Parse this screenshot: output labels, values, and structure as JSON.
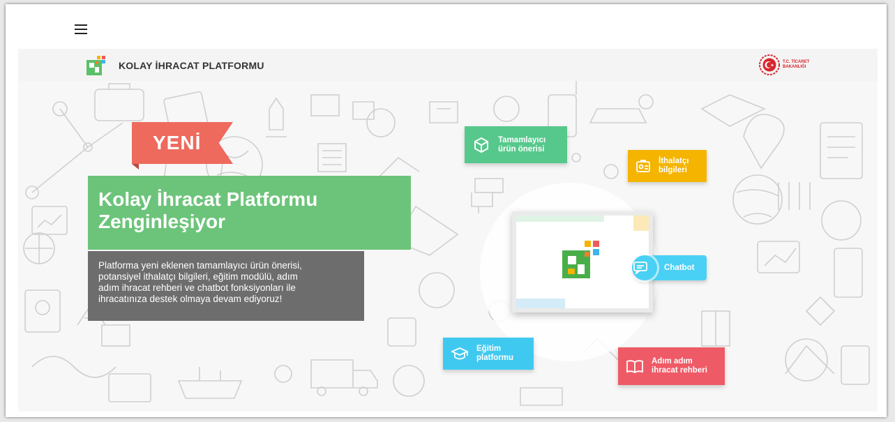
{
  "header": {
    "brand_name": "KOLAY İHRACAT PLATFORMU",
    "ministry_line1": "T.C. TİCARET",
    "ministry_line2": "BAKANLIĞI"
  },
  "hero": {
    "ribbon": "YENİ",
    "headline_line1": "Kolay İhracat Platformu",
    "headline_line2": "Zenginleşiyor",
    "summary_lines": [
      "Platforma yeni eklenen tamamlayıcı ürün önerisi,",
      "potansiyel ithalatçı bilgileri, eğitim modülü, adım",
      "adım ihracat rehberi ve chatbot fonksiyonları ile",
      "ihracatınıza destek olmaya devam ediyoruz!"
    ]
  },
  "features": {
    "product": {
      "line1": "Tamamlayıcı",
      "line2": "ürün önerisi",
      "icon": "cube-icon"
    },
    "importer": {
      "line1": "İthalatçı",
      "line2": "bilgileri",
      "icon": "id-card-icon"
    },
    "chatbot": {
      "label": "Chatbot",
      "icon": "chat-icon"
    },
    "education": {
      "line1": "Eğitim",
      "line2": "platformu",
      "icon": "graduation-cap-icon"
    },
    "guide": {
      "line1": "Adım adım",
      "line2": "ihracat rehberi",
      "icon": "book-icon"
    }
  },
  "colors": {
    "ribbon": "#ee6a5d",
    "headline": "#6cc47a",
    "summary": "#6d6d6d",
    "product": "#56c88b",
    "importer": "#f5b400",
    "chatbot": "#4ad0f4",
    "education": "#40c9f0",
    "guide": "#ee5a66",
    "ministry_red": "#d7262e"
  }
}
